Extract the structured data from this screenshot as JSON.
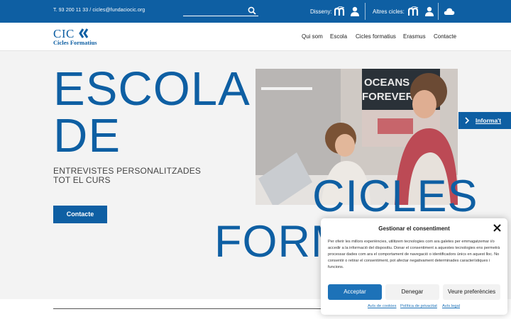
{
  "topbar": {
    "contact": "T. 93 200 11 33 / cicles@fundaciocic.org",
    "search_placeholder": "",
    "disseny_label": "Disseny:",
    "altres_label": "Altres cicles:"
  },
  "logo": {
    "main": "CIC",
    "sub": "Cicles Formatius"
  },
  "nav": [
    "Qui som",
    "Escola",
    "Cicles formatius",
    "Erasmus",
    "Contacte"
  ],
  "hero": {
    "title_line1": "ESCOLA",
    "title_line2": "DE",
    "subhead_line1": "ENTREVISTES PERSONALITZADES",
    "subhead_line2": "TOT EL CURS",
    "cta": "Contacte",
    "cicles": "CICLES",
    "form": "FORM"
  },
  "photo": {
    "poster_text_line1": "OCEANS",
    "poster_text_line2": "FOREVER"
  },
  "informat": "Informa't",
  "consent": {
    "title": "Gestionar el consentiment",
    "body": "Per oferir les millors experiències, utilitzem tecnologies com ara galetes per emmagatzemar i/o accedir a la informació del dispositiu. Donar el consentiment a aquestes tecnologies ens permetrà processar dades com ara el comportament de navegació o identificadors únics en aquest lloc. No consentir o retirar el consentiment, pot afectar negativament determinades característiques i funcions.",
    "accept": "Acceptar",
    "deny": "Denegar",
    "prefs": "Veure preferències",
    "link1": "Avís de cookies",
    "link2": "Política de privacitat",
    "link3": "Avís legal"
  },
  "colors": {
    "brand": "#0e5fa3",
    "accept": "#1d72b8"
  }
}
